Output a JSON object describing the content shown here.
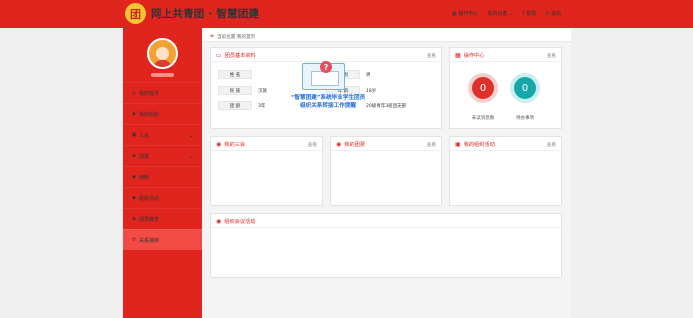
{
  "header": {
    "title": "网上共青团 · 智慧团建",
    "logo_text": "团",
    "nav": {
      "operation_center": "操作中心",
      "system_settings": "系统设置",
      "help": "帮助",
      "logout": "退出"
    }
  },
  "breadcrumb": {
    "text": "当前位置:我的首页"
  },
  "sidebar": {
    "items": [
      {
        "label": "我的首页"
      },
      {
        "label": "我的组织"
      },
      {
        "label": "三会"
      },
      {
        "label": "团费"
      },
      {
        "label": "两制"
      },
      {
        "label": "组织活动"
      },
      {
        "label": "团员教育"
      },
      {
        "label": "关系接转"
      }
    ]
  },
  "basic_info": {
    "title": "团员基本资料",
    "more": "查看",
    "rows": [
      {
        "l1": "姓 名",
        "v1": "",
        "l2": "性 别",
        "v2": "男"
      },
      {
        "l1": "民 族",
        "v1": "汉族",
        "l2": "年 龄",
        "v2": "18岁"
      },
      {
        "l1": "团 龄",
        "v1": "3年",
        "l2": "",
        "v2": "20级青年3班团支部"
      }
    ]
  },
  "popup": {
    "caption_line1": "“智慧团建”系统毕业学生团员",
    "caption_line2": "组织关系转接工作提醒"
  },
  "operation_center": {
    "title": "操作中心",
    "more": "查看",
    "stats": [
      {
        "value": "0",
        "label": "未读消息数",
        "color": "#de302a"
      },
      {
        "value": "0",
        "label": "待办事项",
        "color": "#18a7a8"
      }
    ]
  },
  "cards": {
    "three_meetings": {
      "title": "我的三会",
      "more": "查看"
    },
    "my_league": {
      "title": "我的团费",
      "more": "查看"
    },
    "my_activity": {
      "title": "我的组织活动",
      "more": "查看"
    },
    "org_activity": {
      "title": "组织会议活动",
      "more": ""
    }
  }
}
